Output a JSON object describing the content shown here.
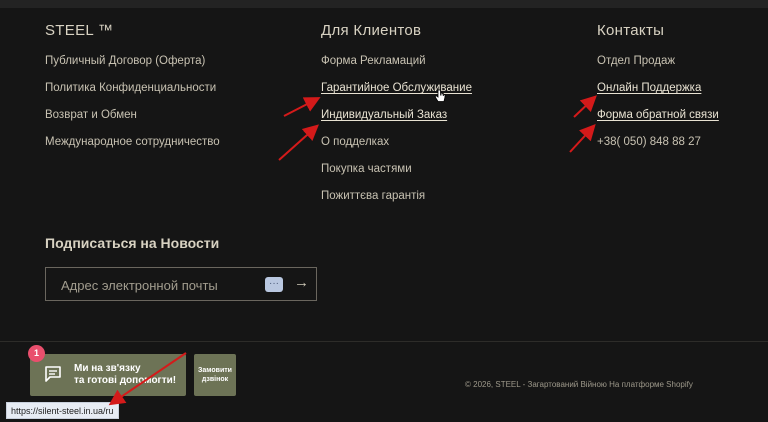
{
  "columns": [
    {
      "title": "STEEL ™",
      "links": [
        "Публичный Договор (Оферта)",
        "Политика Конфиденциальности",
        "Возврат и Обмен",
        "Международное сотрудничество"
      ]
    },
    {
      "title": "Для Клиентов",
      "links": [
        "Форма Рекламаций",
        "Гарантийное Обслуживание",
        "Индивидуальный Заказ",
        "О подделках",
        "Покупка частями",
        "Пожиттєва гарантія"
      ]
    },
    {
      "title": "Контакты",
      "links": [
        "Отдел Продаж",
        "Онлайн Поддержка",
        "Форма обратной связи",
        "+38( 050) 848 88 27"
      ]
    }
  ],
  "newsletter": {
    "title": "Подписаться на Новости",
    "email_placeholder": "Адрес электронной почты",
    "more_label": "···",
    "submit_label": "→"
  },
  "chat_widget": {
    "badge_count": "1",
    "line1": "Ми на зв'язку",
    "line2": "та готові допомогти!",
    "callback_line1": "Замовити",
    "callback_line2": "дзвінок"
  },
  "footer": {
    "copyright": "© 2026, STEEL - Загартований Війною На платформе Shopify"
  },
  "status_bar": {
    "url": "https://silent-steel.in.ua/ru"
  },
  "colors": {
    "background": "#151515",
    "accent_button": "#6d7356",
    "badge": "#e94f6d",
    "annotation_arrow": "#d41a1a"
  }
}
